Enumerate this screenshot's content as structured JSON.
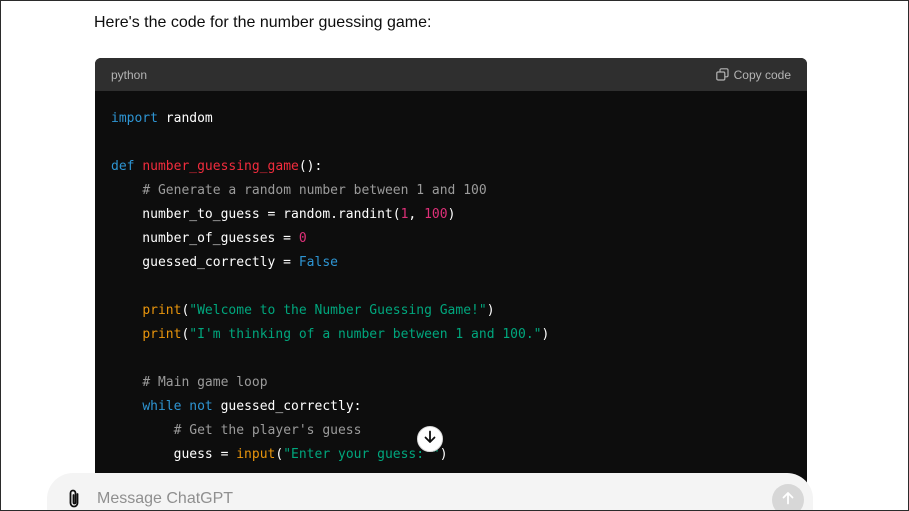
{
  "message": {
    "intro_text": "Here's the code for the number guessing game:"
  },
  "code_block": {
    "language": "python",
    "copy_label": "Copy code",
    "lines": [
      [
        {
          "t": "kw",
          "v": "import"
        },
        {
          "t": "txt",
          "v": " random"
        }
      ],
      [],
      [
        {
          "t": "kw",
          "v": "def"
        },
        {
          "t": "txt",
          "v": " "
        },
        {
          "t": "fn",
          "v": "number_guessing_game"
        },
        {
          "t": "txt",
          "v": "():"
        }
      ],
      [
        {
          "t": "txt",
          "v": "    "
        },
        {
          "t": "cm",
          "v": "# Generate a random number between 1 and 100"
        }
      ],
      [
        {
          "t": "txt",
          "v": "    number_to_guess = random.randint("
        },
        {
          "t": "num",
          "v": "1"
        },
        {
          "t": "txt",
          "v": ", "
        },
        {
          "t": "num",
          "v": "100"
        },
        {
          "t": "txt",
          "v": ")"
        }
      ],
      [
        {
          "t": "txt",
          "v": "    number_of_guesses = "
        },
        {
          "t": "num",
          "v": "0"
        }
      ],
      [
        {
          "t": "txt",
          "v": "    guessed_correctly = "
        },
        {
          "t": "kw",
          "v": "False"
        }
      ],
      [],
      [
        {
          "t": "txt",
          "v": "    "
        },
        {
          "t": "blt",
          "v": "print"
        },
        {
          "t": "txt",
          "v": "("
        },
        {
          "t": "str",
          "v": "\"Welcome to the Number Guessing Game!\""
        },
        {
          "t": "txt",
          "v": ")"
        }
      ],
      [
        {
          "t": "txt",
          "v": "    "
        },
        {
          "t": "blt",
          "v": "print"
        },
        {
          "t": "txt",
          "v": "("
        },
        {
          "t": "str",
          "v": "\"I'm thinking of a number between 1 and 100.\""
        },
        {
          "t": "txt",
          "v": ")"
        }
      ],
      [],
      [
        {
          "t": "txt",
          "v": "    "
        },
        {
          "t": "cm",
          "v": "# Main game loop"
        }
      ],
      [
        {
          "t": "txt",
          "v": "    "
        },
        {
          "t": "kw",
          "v": "while"
        },
        {
          "t": "txt",
          "v": " "
        },
        {
          "t": "kw",
          "v": "not"
        },
        {
          "t": "txt",
          "v": " guessed_correctly:"
        }
      ],
      [
        {
          "t": "txt",
          "v": "        "
        },
        {
          "t": "cm",
          "v": "# Get the player's guess"
        }
      ],
      [
        {
          "t": "txt",
          "v": "        guess = "
        },
        {
          "t": "blt",
          "v": "input"
        },
        {
          "t": "txt",
          "v": "("
        },
        {
          "t": "str",
          "v": "\"Enter your guess: \""
        },
        {
          "t": "txt",
          "v": ")"
        }
      ]
    ]
  },
  "scroll_button": {
    "icon": "arrow-down-icon"
  },
  "composer": {
    "placeholder": "Message ChatGPT",
    "attach_icon": "paperclip-icon",
    "send_icon": "arrow-up-icon"
  },
  "colors": {
    "keyword": "#2e95d3",
    "function": "#f22c3d",
    "comment": "#9b9b9b",
    "number": "#df3079",
    "string": "#00a67d",
    "builtin": "#e9950c",
    "code_bg": "#0d0d0d",
    "code_header_bg": "#2f2f2f"
  }
}
